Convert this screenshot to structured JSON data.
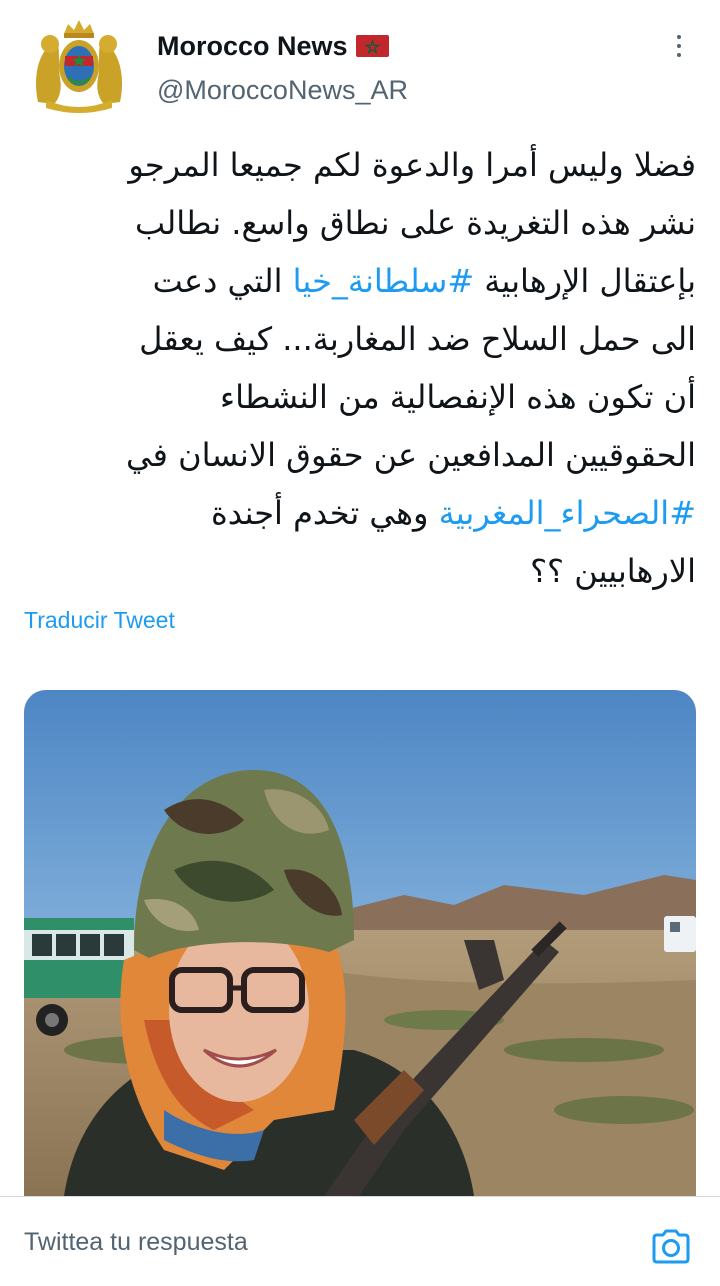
{
  "tweet": {
    "author": {
      "display_name": "Morocco News",
      "handle": "@MoroccoNews_AR",
      "avatar_icon": "moroccan-coat-of-arms",
      "flag_icon": "morocco-flag"
    },
    "text_lines": [
      {
        "before": "فضلا وليس أمرا والدعوة لكم جميعا المرجو"
      },
      {
        "before": "نشر هذه التغريدة على نطاق واسع. نطالب"
      },
      {
        "before": "بإعتقال الإرهابية ",
        "hashtag": "#سلطانة_خيا",
        "after": " التي دعت"
      },
      {
        "before": "الى حمل السلاح ضد المغاربة... كيف يعقل"
      },
      {
        "before": "أن تكون هذه الإنفصالية من النشطاء"
      },
      {
        "before": "الحقوقيين المدافعين عن حقوق الانسان في"
      },
      {
        "before": "",
        "hashtag": "#الصحراء_المغربية",
        "after": " وهي تخدم أجندة"
      },
      {
        "before": "الارهابيين ؟؟"
      }
    ],
    "translate_label": "Traducir Tweet",
    "more_icon": "more-vertical-icon"
  },
  "reply": {
    "placeholder": "Twittea tu respuesta",
    "camera_icon": "camera-icon"
  },
  "colors": {
    "accent": "#1d9bf0",
    "text": "#0f1419",
    "secondary": "#536471",
    "divider": "#cfd9de"
  }
}
